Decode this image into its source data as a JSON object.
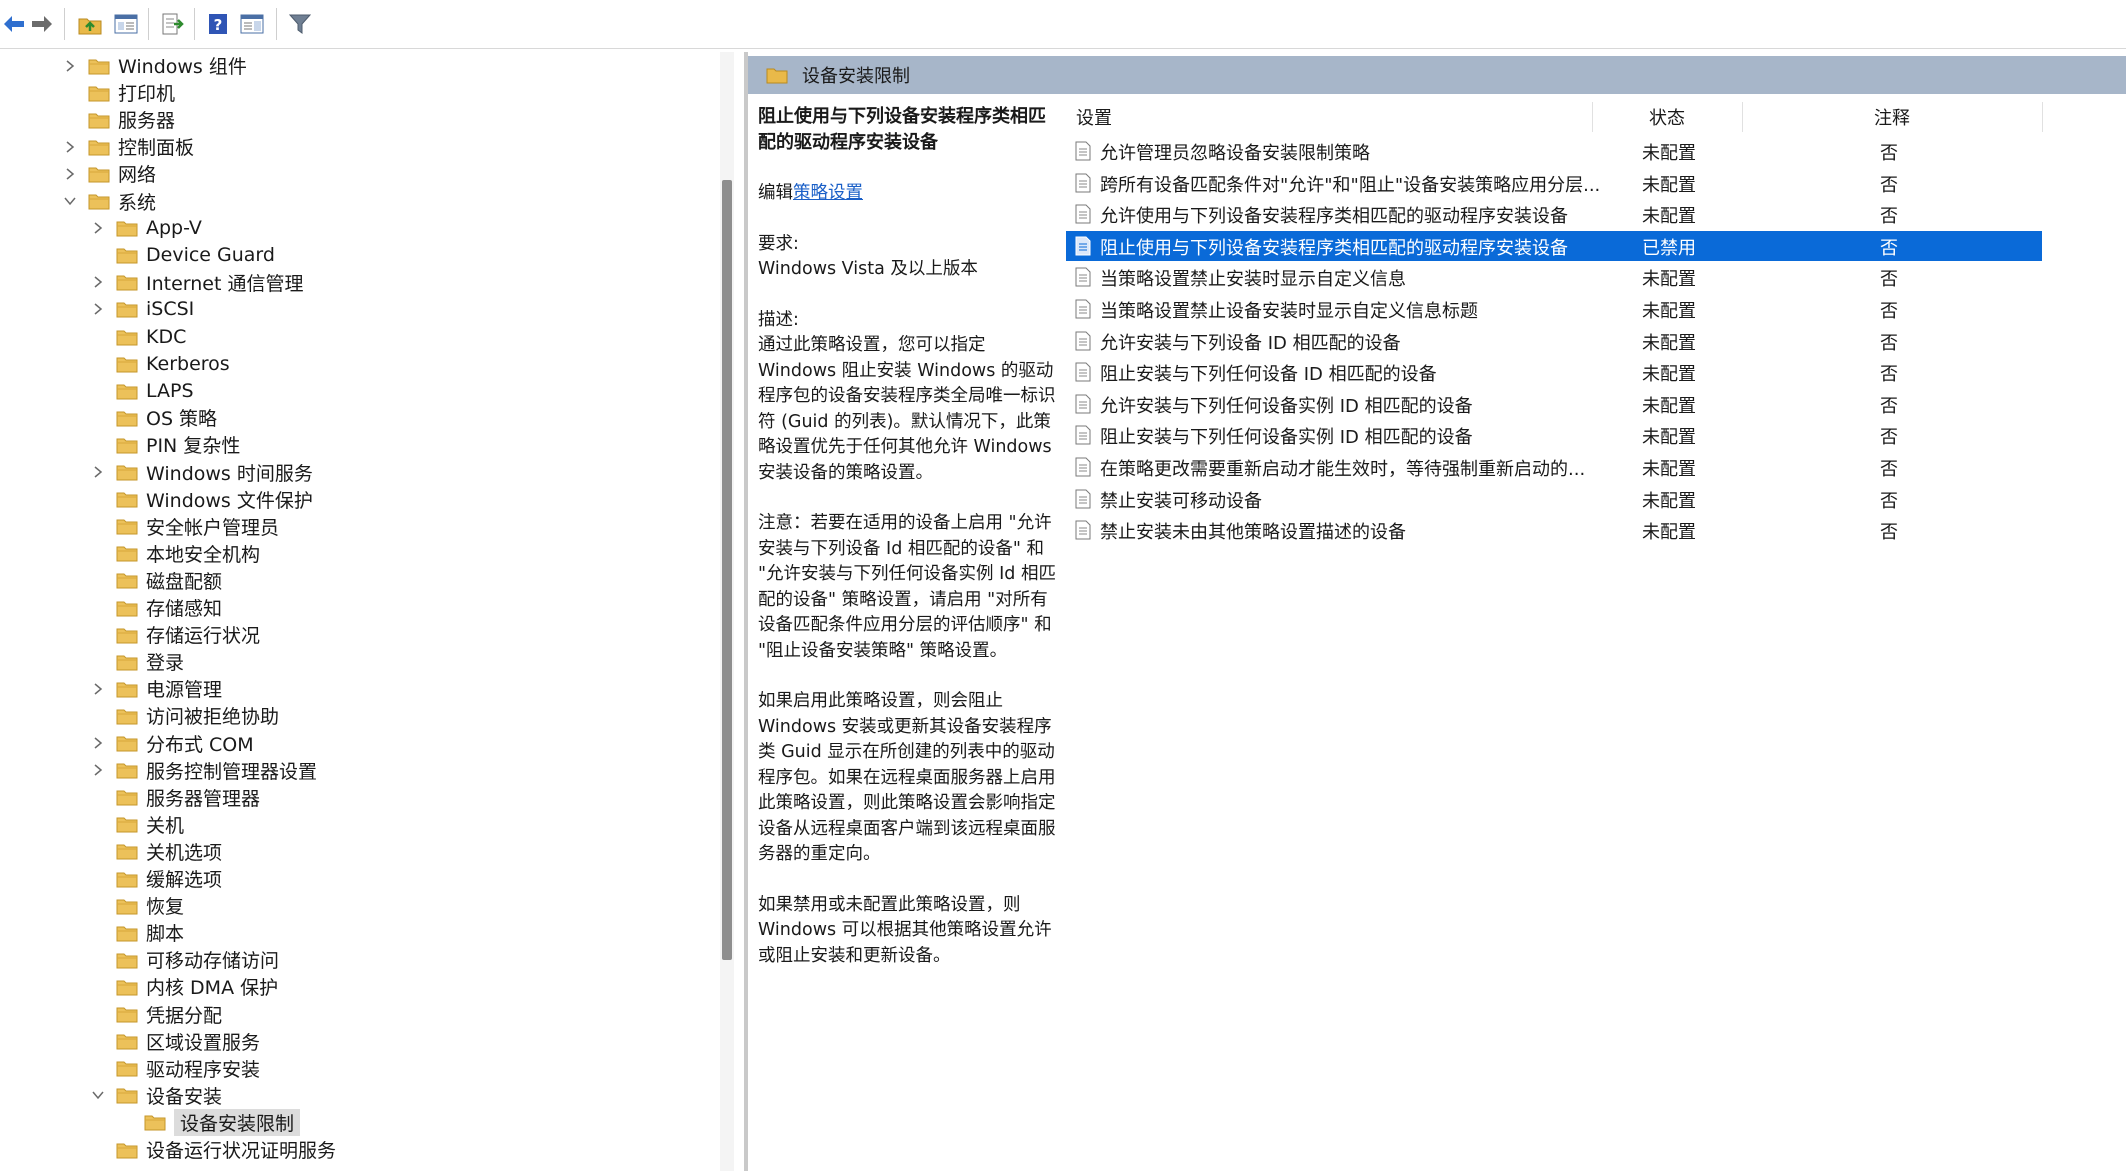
{
  "toolbar": {
    "buttons": [
      {
        "icon": "back-arrow-icon"
      },
      {
        "icon": "forward-arrow-icon"
      },
      {
        "icon": "up-folder-icon"
      },
      {
        "icon": "show-hide-tree-icon"
      },
      {
        "icon": "export-list-icon"
      },
      {
        "icon": "help-icon"
      },
      {
        "icon": "properties-pane-icon"
      },
      {
        "icon": "filter-icon"
      }
    ]
  },
  "tree": {
    "items": [
      {
        "label": "Windows 组件",
        "indent": 0,
        "chevron": "right"
      },
      {
        "label": "打印机",
        "indent": 0,
        "chevron": "none"
      },
      {
        "label": "服务器",
        "indent": 0,
        "chevron": "none"
      },
      {
        "label": "控制面板",
        "indent": 0,
        "chevron": "right"
      },
      {
        "label": "网络",
        "indent": 0,
        "chevron": "right"
      },
      {
        "label": "系统",
        "indent": 0,
        "chevron": "down"
      },
      {
        "label": "App-V",
        "indent": 1,
        "chevron": "right"
      },
      {
        "label": "Device Guard",
        "indent": 1,
        "chevron": "none"
      },
      {
        "label": "Internet 通信管理",
        "indent": 1,
        "chevron": "right"
      },
      {
        "label": "iSCSI",
        "indent": 1,
        "chevron": "right"
      },
      {
        "label": "KDC",
        "indent": 1,
        "chevron": "none"
      },
      {
        "label": "Kerberos",
        "indent": 1,
        "chevron": "none"
      },
      {
        "label": "LAPS",
        "indent": 1,
        "chevron": "none"
      },
      {
        "label": "OS 策略",
        "indent": 1,
        "chevron": "none"
      },
      {
        "label": "PIN 复杂性",
        "indent": 1,
        "chevron": "none"
      },
      {
        "label": "Windows 时间服务",
        "indent": 1,
        "chevron": "right"
      },
      {
        "label": "Windows 文件保护",
        "indent": 1,
        "chevron": "none"
      },
      {
        "label": "安全帐户管理员",
        "indent": 1,
        "chevron": "none"
      },
      {
        "label": "本地安全机构",
        "indent": 1,
        "chevron": "none"
      },
      {
        "label": "磁盘配额",
        "indent": 1,
        "chevron": "none"
      },
      {
        "label": "存储感知",
        "indent": 1,
        "chevron": "none"
      },
      {
        "label": "存储运行状况",
        "indent": 1,
        "chevron": "none"
      },
      {
        "label": "登录",
        "indent": 1,
        "chevron": "none"
      },
      {
        "label": "电源管理",
        "indent": 1,
        "chevron": "right"
      },
      {
        "label": "访问被拒绝协助",
        "indent": 1,
        "chevron": "none"
      },
      {
        "label": "分布式 COM",
        "indent": 1,
        "chevron": "right"
      },
      {
        "label": "服务控制管理器设置",
        "indent": 1,
        "chevron": "right"
      },
      {
        "label": "服务器管理器",
        "indent": 1,
        "chevron": "none"
      },
      {
        "label": "关机",
        "indent": 1,
        "chevron": "none"
      },
      {
        "label": "关机选项",
        "indent": 1,
        "chevron": "none"
      },
      {
        "label": "缓解选项",
        "indent": 1,
        "chevron": "none"
      },
      {
        "label": "恢复",
        "indent": 1,
        "chevron": "none"
      },
      {
        "label": "脚本",
        "indent": 1,
        "chevron": "none"
      },
      {
        "label": "可移动存储访问",
        "indent": 1,
        "chevron": "none"
      },
      {
        "label": "内核 DMA 保护",
        "indent": 1,
        "chevron": "none"
      },
      {
        "label": "凭据分配",
        "indent": 1,
        "chevron": "none"
      },
      {
        "label": "区域设置服务",
        "indent": 1,
        "chevron": "none"
      },
      {
        "label": "驱动程序安装",
        "indent": 1,
        "chevron": "none"
      },
      {
        "label": "设备安装",
        "indent": 1,
        "chevron": "down"
      },
      {
        "label": "设备安装限制",
        "indent": 2,
        "chevron": "none",
        "selected": true
      },
      {
        "label": "设备运行状况证明服务",
        "indent": 1,
        "chevron": "none"
      }
    ]
  },
  "pane": {
    "title": "设备安装限制"
  },
  "description": {
    "title": "阻止使用与下列设备安装程序类相匹配的驱动程序安装设备",
    "edit_prefix": "编辑",
    "edit_link": "策略设置",
    "req_label": "要求:",
    "req_value": "Windows Vista 及以上版本",
    "desc_label": "描述:",
    "desc_text": "通过此策略设置，您可以指定 Windows 阻止安装 Windows 的驱动程序包的设备安装程序类全局唯一标识符 (Guid 的列表)。默认情况下，此策略设置优先于任何其他允许 Windows 安装设备的策略设置。",
    "note_text": "注意：若要在适用的设备上启用 \"允许安装与下列设备 Id 相匹配的设备\" 和 \"允许安装与下列任何设备实例 Id 相匹配的设备\" 策略设置，请启用 \"对所有设备匹配条件应用分层的评估顺序\" 和 \"阻止设备安装策略\" 策略设置。",
    "enable_text": "如果启用此策略设置，则会阻止 Windows 安装或更新其设备安装程序类 Guid 显示在所创建的列表中的驱动程序包。如果在远程桌面服务器上启用此策略设置，则此策略设置会影响指定设备从远程桌面客户端到该远程桌面服务器的重定向。",
    "disable_text": "如果禁用或未配置此策略设置，则 Windows 可以根据其他策略设置允许或阻止安装和更新设备。"
  },
  "list": {
    "columns": {
      "setting": "设置",
      "state": "状态",
      "note": "注释"
    },
    "rows": [
      {
        "name": "允许管理员忽略设备安装限制策略",
        "state": "未配置",
        "note": "否"
      },
      {
        "name": "跨所有设备匹配条件对\"允许\"和\"阻止\"设备安装策略应用分层...",
        "state": "未配置",
        "note": "否"
      },
      {
        "name": "允许使用与下列设备安装程序类相匹配的驱动程序安装设备",
        "state": "未配置",
        "note": "否"
      },
      {
        "name": "阻止使用与下列设备安装程序类相匹配的驱动程序安装设备",
        "state": "已禁用",
        "note": "否",
        "selected": true
      },
      {
        "name": "当策略设置禁止安装时显示自定义信息",
        "state": "未配置",
        "note": "否"
      },
      {
        "name": "当策略设置禁止设备安装时显示自定义信息标题",
        "state": "未配置",
        "note": "否"
      },
      {
        "name": "允许安装与下列设备 ID 相匹配的设备",
        "state": "未配置",
        "note": "否"
      },
      {
        "name": "阻止安装与下列任何设备 ID 相匹配的设备",
        "state": "未配置",
        "note": "否"
      },
      {
        "name": "允许安装与下列任何设备实例 ID 相匹配的设备",
        "state": "未配置",
        "note": "否"
      },
      {
        "name": "阻止安装与下列任何设备实例 ID 相匹配的设备",
        "state": "未配置",
        "note": "否"
      },
      {
        "name": "在策略更改需要重新启动才能生效时，等待强制重新启动的...",
        "state": "未配置",
        "note": "否"
      },
      {
        "name": "禁止安装可移动设备",
        "state": "未配置",
        "note": "否"
      },
      {
        "name": "禁止安装未由其他策略设置描述的设备",
        "state": "未配置",
        "note": "否"
      }
    ]
  },
  "colors": {
    "selection": "#0a6ad8",
    "header_bar": "#a7b6c9",
    "link": "#1a5fc7",
    "folder": "#e9b949"
  }
}
